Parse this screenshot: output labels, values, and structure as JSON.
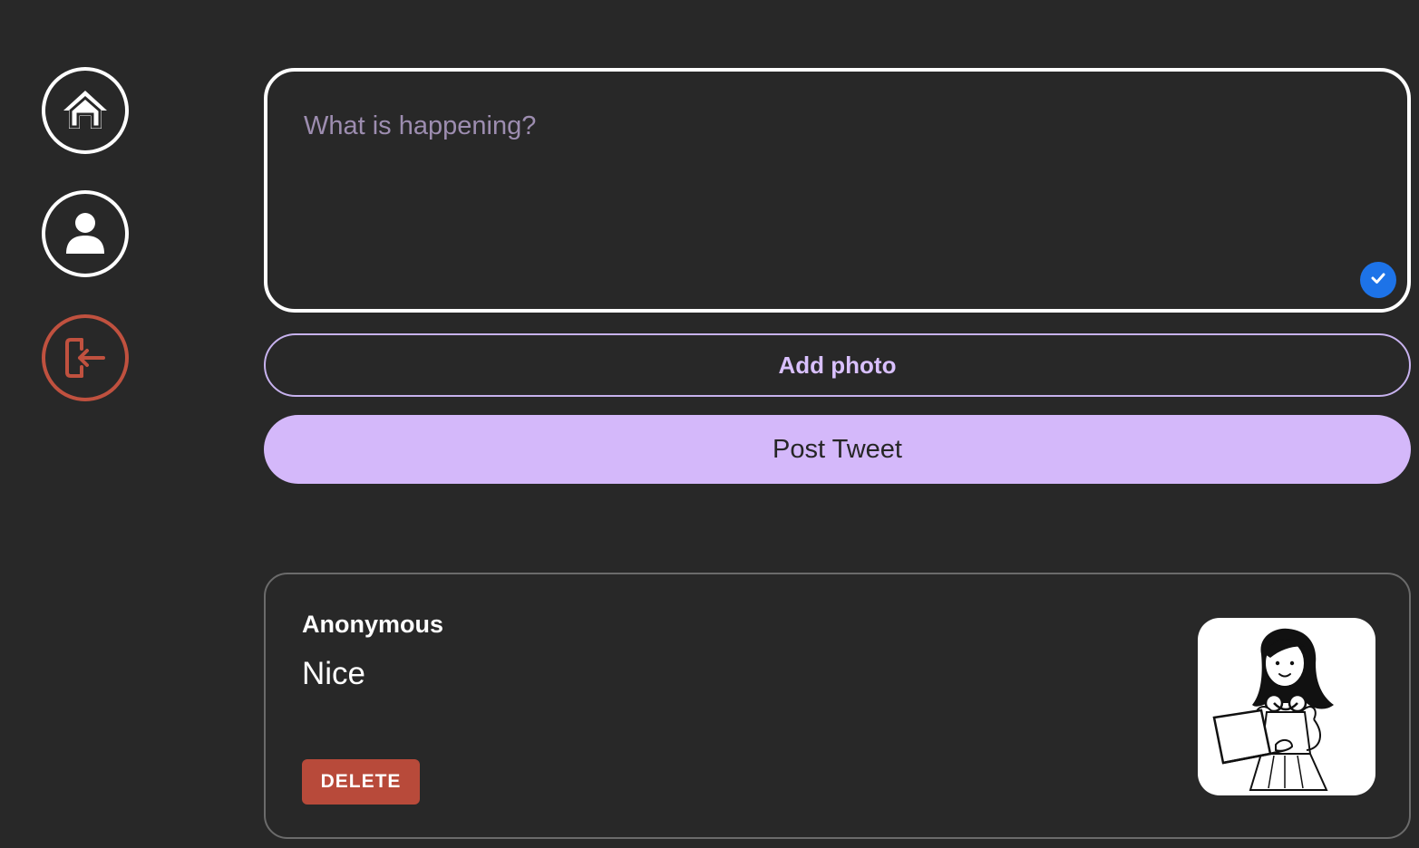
{
  "nav": {
    "items": [
      {
        "icon": "home-icon",
        "color": "#ffffff"
      },
      {
        "icon": "user-icon",
        "color": "#ffffff"
      },
      {
        "icon": "logout-icon",
        "color": "#c0513f"
      }
    ]
  },
  "compose": {
    "placeholder": "What is happening?",
    "value": "",
    "badge_icon": "check-icon",
    "badge_color": "#1d73e8"
  },
  "actions": {
    "add_photo_label": "Add photo",
    "post_label": "Post Tweet"
  },
  "tweets": [
    {
      "author": "Anonymous",
      "text": "Nice",
      "delete_label": "DELETE",
      "photo": "girl-with-laptop-illustration"
    }
  ],
  "colors": {
    "background": "#282828",
    "accent": "#d4b8fa",
    "danger": "#b84a3a"
  }
}
